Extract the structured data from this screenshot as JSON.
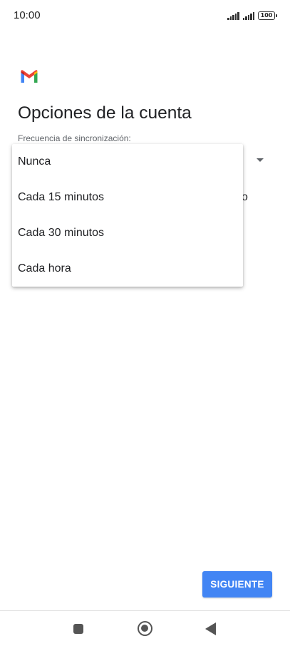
{
  "status_bar": {
    "time": "10:00",
    "battery": "100"
  },
  "icons": {
    "app_logo": "gmail-logo-icon",
    "dropdown": "arrow-drop-down-icon",
    "nav_recents": "square-icon",
    "nav_home": "circle-icon",
    "nav_back": "triangle-back-icon"
  },
  "page": {
    "title": "Opciones de la cuenta",
    "sync_label": "Frecuencia de sincronización:",
    "obscured_text_fragment": "o"
  },
  "dropdown": {
    "options": [
      "Nunca",
      "Cada 15 minutos",
      "Cada 30 minutos",
      "Cada hora"
    ]
  },
  "footer": {
    "next_label": "SIGUIENTE"
  },
  "colors": {
    "primary_button": "#4285f4",
    "gmail_red": "#ea4335",
    "gmail_blue": "#4285f4",
    "gmail_green": "#34a853",
    "gmail_yellow": "#fbbc04"
  }
}
